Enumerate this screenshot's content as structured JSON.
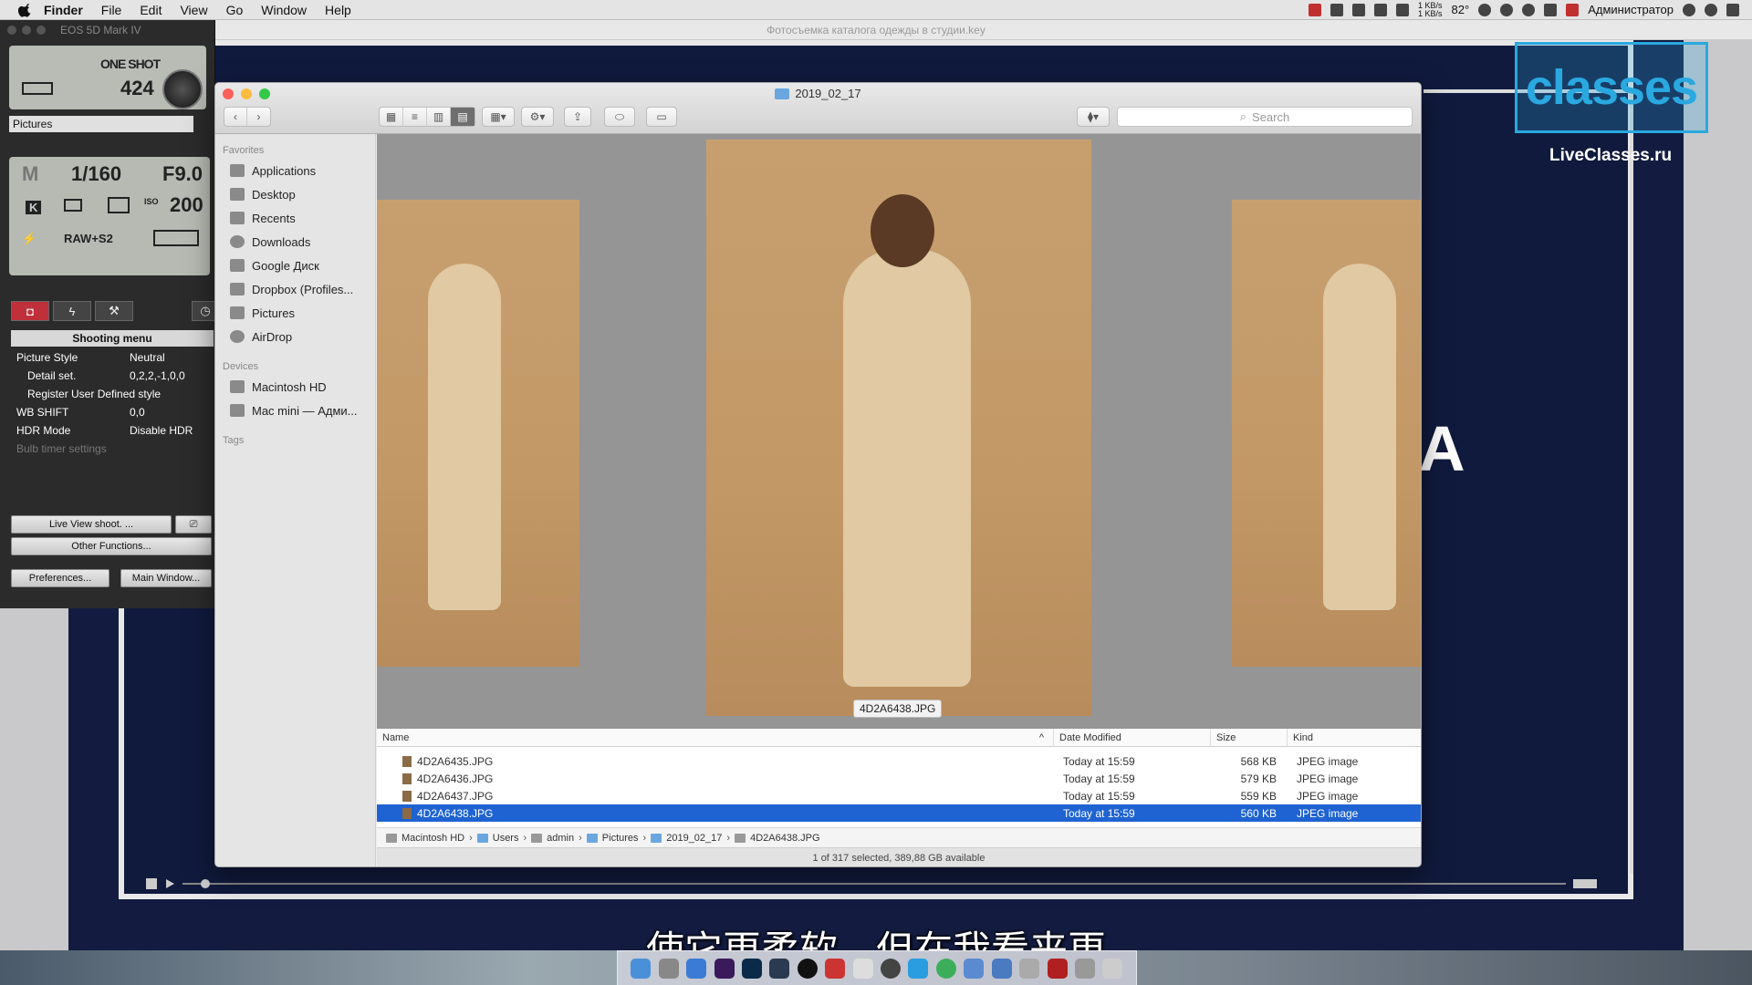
{
  "menubar": {
    "app": "Finder",
    "items": [
      "File",
      "Edit",
      "View",
      "Go",
      "Window",
      "Help"
    ],
    "net_up": "1 KB/s",
    "net_down": "1 KB/s",
    "temp": "82°",
    "user": "Администратор"
  },
  "keynote": {
    "doc_title": "Фотосъемка каталога одежды в студии.key",
    "logo_text": "classes",
    "site": "LiveClasses.ru"
  },
  "eos": {
    "window_title": "EOS 5D Mark IV",
    "mode": "ONE SHOT",
    "shots": "424",
    "folder": "Pictures",
    "exposure_mode": "M",
    "shutter": "1/160",
    "aperture": "F9.0",
    "iso_label": "ISO",
    "iso": "200",
    "wb": "K",
    "quality": "RAW+S2",
    "menu_title": "Shooting menu",
    "menu_rows": [
      {
        "key": "Picture Style",
        "value": "Neutral"
      },
      {
        "key": "Detail set.",
        "value": "0,2,2,-1,0,0"
      },
      {
        "key": "Register User Defined style",
        "value": ""
      },
      {
        "key": "WB SHIFT",
        "value": "0,0"
      },
      {
        "key": "HDR Mode",
        "value": "Disable HDR"
      },
      {
        "key": "Bulb timer settings",
        "value": ""
      }
    ],
    "live_view_btn": "Live View shoot. ...",
    "other_btn": "Other Functions...",
    "pref_btn": "Preferences...",
    "main_btn": "Main Window..."
  },
  "finder": {
    "title": "2019_02_17",
    "search_placeholder": "Search",
    "sidebar": {
      "favorites_label": "Favorites",
      "favorites": [
        "Applications",
        "Desktop",
        "Recents",
        "Downloads",
        "Google Диск",
        "Dropbox (Profiles...",
        "Pictures",
        "AirDrop"
      ],
      "devices_label": "Devices",
      "devices": [
        "Macintosh HD",
        "Mac mini — Адми..."
      ],
      "tags_label": "Tags"
    },
    "preview_caption": "4D2A6438.JPG",
    "columns": {
      "name": "Name",
      "date": "Date Modified",
      "size": "Size",
      "kind": "Kind"
    },
    "files": [
      {
        "name": "4D2A6435.JPG",
        "date": "Today at 15:59",
        "size": "568 KB",
        "kind": "JPEG image"
      },
      {
        "name": "4D2A6436.JPG",
        "date": "Today at 15:59",
        "size": "579 KB",
        "kind": "JPEG image"
      },
      {
        "name": "4D2A6437.JPG",
        "date": "Today at 15:59",
        "size": "559 KB",
        "kind": "JPEG image"
      },
      {
        "name": "4D2A6438.JPG",
        "date": "Today at 15:59",
        "size": "560 KB",
        "kind": "JPEG image"
      }
    ],
    "selected_index": 3,
    "path": [
      "Macintosh HD",
      "Users",
      "admin",
      "Pictures",
      "2019_02_17",
      "4D2A6438.JPG"
    ],
    "status": "1 of 317 selected, 389,88 GB available"
  },
  "subtitle": "使它更柔软，但在我看来更",
  "colors": {
    "selection": "#1e63d1",
    "brand": "#2aa8e0"
  }
}
